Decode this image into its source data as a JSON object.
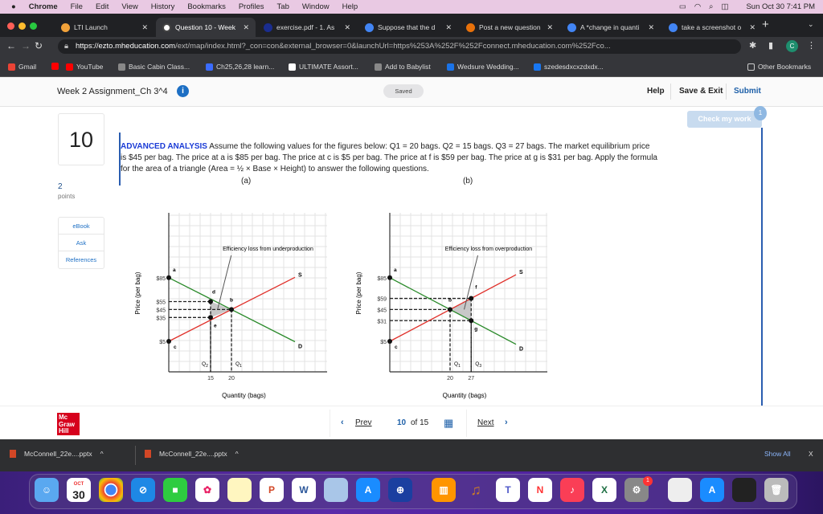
{
  "menubar": {
    "apple": "",
    "app": "Chrome",
    "items": [
      "File",
      "Edit",
      "View",
      "History",
      "Bookmarks",
      "Profiles",
      "Tab",
      "Window",
      "Help"
    ],
    "clock": "Sun Oct 30  7:41 PM"
  },
  "tabs": [
    {
      "label": "LTI Launch",
      "color": "#f2a23a",
      "active": false
    },
    {
      "label": "Question 10 - Week",
      "color": "#ffffff",
      "active": true
    },
    {
      "label": "exercise.pdf - 1. As",
      "color": "#1a2d8f",
      "active": false
    },
    {
      "label": "Suppose that the d",
      "color": "#4285f4",
      "active": false
    },
    {
      "label": "Post a new question",
      "color": "#e8710a",
      "active": false
    },
    {
      "label": "A *change in quanti",
      "color": "#4285f4",
      "active": false
    },
    {
      "label": "take a screenshot o",
      "color": "#4285f4",
      "active": false
    }
  ],
  "address": {
    "host": "https://ezto.mheducation.com",
    "path": "/ext/map/index.html?_con=con&external_browser=0&launchUrl=https%253A%252F%252Fconnect.mheducation.com%252Fco...",
    "profile": "C"
  },
  "bookmarks": [
    {
      "label": "Gmail",
      "color": "#ea4335"
    },
    {
      "label": "",
      "color": "#ff0000"
    },
    {
      "label": "YouTube",
      "color": "#ff0000"
    },
    {
      "label": "Basic Cabin Class...",
      "color": "#888888"
    },
    {
      "label": "Ch25,26,28 learn...",
      "color": "#3b6cff"
    },
    {
      "label": "ULTIMATE Assort...",
      "color": "#ffffff"
    },
    {
      "label": "Add to Babylist",
      "color": "#888888"
    },
    {
      "label": "Wedsure Wedding...",
      "color": "#1a73e8"
    },
    {
      "label": "szedesdxcxzdxdx...",
      "color": "#1877f2"
    }
  ],
  "other_bookmarks": "Other Bookmarks",
  "header": {
    "title": "Week 2 Assignment_Ch 3^4",
    "saved": "Saved",
    "help": "Help",
    "save_exit": "Save & Exit",
    "submit": "Submit"
  },
  "question": {
    "number": "10",
    "points_value": "2",
    "points_label": "points",
    "check_label": "Check my work",
    "check_badge": "1",
    "side_links": [
      "eBook",
      "Ask",
      "References"
    ],
    "heading": "ADVANCED ANALYSIS",
    "text": " Assume the following values for the figures below: Q1 = 20 bags. Q2 = 15 bags. Q3 = 27 bags. The market equilibrium price is $45 per bag. The price at a is $85 per bag. The price at c is $5 per bag. The price at f is $59 per bag. The price at g is $31 per bag. Apply the formula for the area of a triangle (Area = ½ × Base × Height) to answer the following questions.",
    "fig_a": "(a)",
    "fig_b": "(b)"
  },
  "chart_data": [
    {
      "type": "line",
      "annotation": "Efficiency loss from underproduction",
      "xlabel": "Quantity (bags)",
      "ylabel": "Price (per bag)",
      "yticks": [
        "$85",
        "$55",
        "$45",
        "$35",
        "$5"
      ],
      "ytick_values": [
        85,
        55,
        45,
        35,
        5
      ],
      "xticks": [
        "15",
        "20"
      ],
      "xtick_values": [
        15,
        20
      ],
      "qlabels": [
        {
          "label": "Q2",
          "q": 15
        },
        {
          "label": "Q1",
          "q": 20
        }
      ],
      "series": [
        {
          "name": "D",
          "color": "#2a8a2a"
        },
        {
          "name": "S",
          "color": "#e0302a"
        }
      ],
      "points": [
        {
          "label": "a",
          "q": 0,
          "p": 85
        },
        {
          "label": "c",
          "q": 0,
          "p": 5
        },
        {
          "label": "d",
          "q": 15,
          "p": 55
        },
        {
          "label": "b",
          "q": 20,
          "p": 45
        },
        {
          "label": "e",
          "q": 15,
          "p": 35
        }
      ],
      "shaded": [
        "d",
        "b",
        "e"
      ],
      "grid": true
    },
    {
      "type": "line",
      "annotation": "Efficiency loss from overproduction",
      "xlabel": "Quantity (bags)",
      "ylabel": "Price (per bag)",
      "yticks": [
        "$85",
        "$59",
        "$45",
        "$31",
        "$5"
      ],
      "ytick_values": [
        85,
        59,
        45,
        31,
        5
      ],
      "xticks": [
        "20",
        "27"
      ],
      "xtick_values": [
        20,
        27
      ],
      "qlabels": [
        {
          "label": "Q1",
          "q": 20
        },
        {
          "label": "Q3",
          "q": 27
        }
      ],
      "series": [
        {
          "name": "D",
          "color": "#2a8a2a"
        },
        {
          "name": "S",
          "color": "#e0302a"
        }
      ],
      "points": [
        {
          "label": "a",
          "q": 0,
          "p": 85
        },
        {
          "label": "c",
          "q": 0,
          "p": 5
        },
        {
          "label": "b",
          "q": 20,
          "p": 45
        },
        {
          "label": "f",
          "q": 27,
          "p": 59
        },
        {
          "label": "g",
          "q": 27,
          "p": 31
        }
      ],
      "shaded": [
        "b",
        "f",
        "g"
      ],
      "grid": true
    }
  ],
  "footer": {
    "logo": "Mc Graw Hill",
    "prev": "Prev",
    "current": "10",
    "of": "of 15",
    "next": "Next"
  },
  "downloads": {
    "items": [
      "McConnell_22e....pptx",
      "McConnell_22e....pptx"
    ],
    "show_all": "Show All",
    "close": "X"
  },
  "dock": {
    "calendar_month": "OCT",
    "calendar_day": "30",
    "settings_badge": "1"
  }
}
